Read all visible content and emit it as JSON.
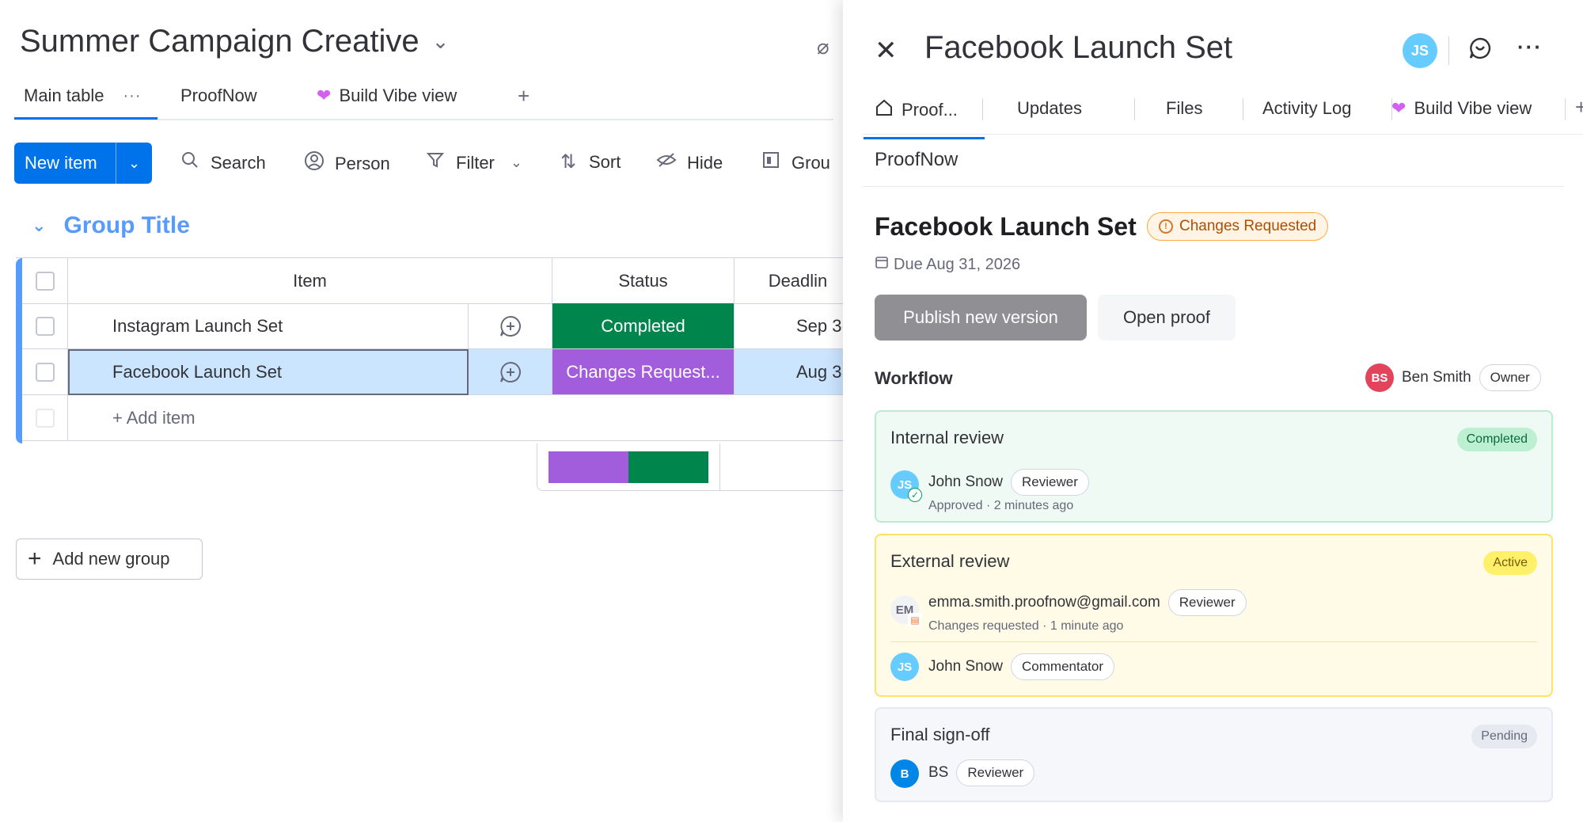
{
  "board": {
    "title": "Summer Campaign Creative",
    "tabs": [
      {
        "label": "Main table"
      },
      {
        "label": "ProofNow"
      },
      {
        "label": "Build Vibe view"
      }
    ],
    "tab_plus": "+",
    "toolbar": {
      "new_item": "New item",
      "search": "Search",
      "person": "Person",
      "filter": "Filter",
      "sort": "Sort",
      "hide": "Hide",
      "group": "Grou"
    },
    "group_title": "Group Title",
    "columns": {
      "item": "Item",
      "status": "Status",
      "deadline": "Deadlin"
    },
    "rows": [
      {
        "item": "Instagram Launch Set",
        "status": "Completed",
        "status_color": "#00854d",
        "deadline": "Sep 3("
      },
      {
        "item": "Facebook Launch Set",
        "status": "Changes Request...",
        "status_color": "#a25ddc",
        "deadline": "Aug 3"
      }
    ],
    "add_item": "+ Add item",
    "summary": [
      {
        "color": "#a25ddc",
        "fraction": 0.5
      },
      {
        "color": "#00854d",
        "fraction": 0.5
      }
    ],
    "add_group": "Add new group"
  },
  "panel": {
    "title": "Facebook Launch Set",
    "avatar": "JS",
    "tabs": [
      {
        "label": "Proof..."
      },
      {
        "label": "Updates"
      },
      {
        "label": "Files"
      },
      {
        "label": "Activity Log"
      },
      {
        "label": "Build Vibe view"
      }
    ],
    "tab_plus": "+",
    "section": "ProofNow",
    "item_title": "Facebook Launch Set",
    "item_status": "Changes Requested",
    "due": "Due Aug 31, 2026",
    "publish_btn": "Publish new version",
    "open_btn": "Open proof",
    "workflow_label": "Workflow",
    "owner": {
      "initials": "BS",
      "name": "Ben Smith",
      "role": "Owner"
    },
    "stages": [
      {
        "title": "Internal review",
        "badge": "Completed",
        "people": [
          {
            "initials": "JS",
            "name": "John Snow",
            "role": "Reviewer",
            "status": "Approved · 2 minutes ago"
          }
        ]
      },
      {
        "title": "External review",
        "badge": "Active",
        "people": [
          {
            "initials": "EM",
            "name": "emma.smith.proofnow@gmail.com",
            "role": "Reviewer",
            "status": "Changes requested · 1 minute ago"
          },
          {
            "initials": "JS",
            "name": "John Snow",
            "role": "Commentator"
          }
        ]
      },
      {
        "title": "Final sign-off",
        "badge": "Pending",
        "people": [
          {
            "initials": "B",
            "name": "BS",
            "role": "Reviewer"
          }
        ]
      }
    ]
  },
  "colors": {
    "primary": "#0073ea",
    "group": "#579bfc",
    "completed": "#00854d",
    "changes": "#a25ddc",
    "selected_row": "#cce5ff"
  }
}
